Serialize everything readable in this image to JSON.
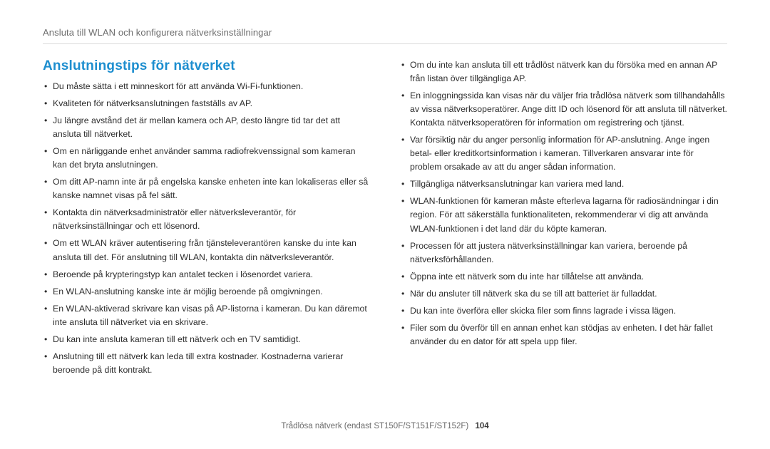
{
  "header": {
    "breadcrumb": "Ansluta till WLAN och konfigurera nätverksinställningar"
  },
  "title": "Anslutningstips för nätverket",
  "left": [
    "Du måste sätta i ett minneskort för att använda Wi-Fi-funktionen.",
    "Kvaliteten för nätverksanslutningen fastställs av AP.",
    "Ju längre avstånd det är mellan kamera och AP, desto längre tid tar det att ansluta till nätverket.",
    "Om en närliggande enhet använder samma radiofrekvenssignal som kameran kan det bryta anslutningen.",
    "Om ditt AP-namn inte är på engelska kanske enheten inte kan lokaliseras eller så kanske namnet visas på fel sätt.",
    "Kontakta din nätverksadministratör eller nätverksleverantör, för nätverksinställningar och ett lösenord.",
    "Om ett WLAN kräver autentisering från tjänsteleverantören kanske du inte kan ansluta till det. För anslutning till WLAN, kontakta din nätverksleverantör.",
    "Beroende på krypteringstyp kan antalet tecken i lösenordet variera.",
    "En WLAN-anslutning kanske inte är möjlig beroende på omgivningen.",
    "En WLAN-aktiverad skrivare kan visas på AP-listorna i kameran. Du kan däremot inte ansluta till nätverket via en skrivare.",
    "Du kan inte ansluta kameran till ett nätverk och en TV samtidigt.",
    "Anslutning till ett nätverk kan leda till extra kostnader. Kostnaderna varierar beroende på ditt kontrakt."
  ],
  "right": [
    "Om du inte kan ansluta till ett trådlöst nätverk kan du försöka med en annan AP från listan över tillgängliga AP.",
    "En inloggningssida kan visas när du väljer fria trådlösa nätverk som tillhandahålls av vissa nätverksoperatörer. Ange ditt ID och lösenord för att ansluta till nätverket. Kontakta nätverksoperatören för information om registrering och tjänst.",
    "Var försiktig när du anger personlig information för AP-anslutning. Ange ingen betal- eller kreditkortsinformation i kameran. Tillverkaren ansvarar inte för problem orsakade av att du anger sådan information.",
    "Tillgängliga nätverksanslutningar kan variera med land.",
    "WLAN-funktionen för kameran måste efterleva lagarna för radiosändningar i din region. För att säkerställa funktionaliteten, rekommenderar vi dig att använda WLAN-funktionen i det land där du köpte kameran.",
    "Processen för att justera nätverksinställningar kan variera, beroende på nätverksförhållanden.",
    "Öppna inte ett nätverk som du inte har tillåtelse att använda.",
    "När du ansluter till nätverk ska du se till att batteriet är fulladdat.",
    "Du kan inte överföra eller skicka filer som finns lagrade i vissa lägen.",
    "Filer som du överför till en annan enhet kan stödjas av enheten. I det här fallet använder du en dator för att spela upp filer."
  ],
  "footer": {
    "text": "Trådlösa nätverk (endast ST150F/ST151F/ST152F)",
    "page": "104"
  }
}
